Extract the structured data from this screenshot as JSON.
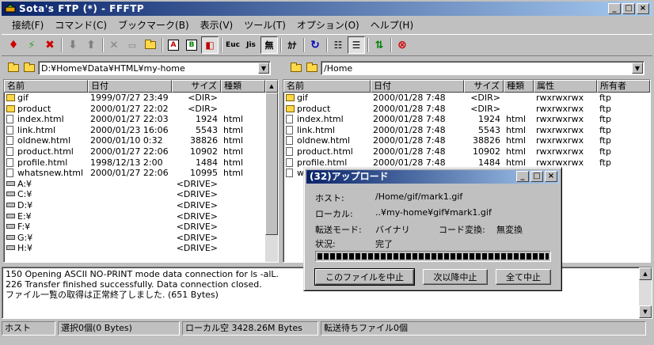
{
  "window": {
    "title": "Sota's FTP (*) - FFFTP"
  },
  "menu": [
    "接続(F)",
    "コマンド(C)",
    "ブックマーク(B)",
    "表示(V)",
    "ツール(T)",
    "オプション(O)",
    "ヘルプ(H)"
  ],
  "toolbar": {
    "ascii_label": "A",
    "binary_label": "B",
    "euc_label": "Euc",
    "jis_label": "Jis",
    "none_label": "無",
    "kana_label": "ｶﾅ"
  },
  "local": {
    "path": "D:¥Home¥Data¥HTML¥my-home",
    "columns": [
      "名前",
      "日付",
      "サイズ",
      "種類"
    ],
    "rows": [
      {
        "name": "gif",
        "date": "1999/07/27 23:49",
        "size": "<DIR>",
        "type": "",
        "kind": "folder"
      },
      {
        "name": "product",
        "date": "2000/01/27 22:02",
        "size": "<DIR>",
        "type": "",
        "kind": "folder"
      },
      {
        "name": "index.html",
        "date": "2000/01/27 22:03",
        "size": "1924",
        "type": "html",
        "kind": "file"
      },
      {
        "name": "link.html",
        "date": "2000/01/23 16:06",
        "size": "5543",
        "type": "html",
        "kind": "file"
      },
      {
        "name": "oldnew.html",
        "date": "2000/01/10  0:32",
        "size": "38826",
        "type": "html",
        "kind": "file"
      },
      {
        "name": "product.html",
        "date": "2000/01/27 22:06",
        "size": "10902",
        "type": "html",
        "kind": "file"
      },
      {
        "name": "profile.html",
        "date": "1998/12/13  2:00",
        "size": "1484",
        "type": "html",
        "kind": "file"
      },
      {
        "name": "whatsnew.html",
        "date": "2000/01/27 22:06",
        "size": "10995",
        "type": "html",
        "kind": "file"
      },
      {
        "name": "A:¥",
        "date": "",
        "size": "<DRIVE>",
        "type": "",
        "kind": "drive"
      },
      {
        "name": "C:¥",
        "date": "",
        "size": "<DRIVE>",
        "type": "",
        "kind": "drive"
      },
      {
        "name": "D:¥",
        "date": "",
        "size": "<DRIVE>",
        "type": "",
        "kind": "drive"
      },
      {
        "name": "E:¥",
        "date": "",
        "size": "<DRIVE>",
        "type": "",
        "kind": "drive"
      },
      {
        "name": "F:¥",
        "date": "",
        "size": "<DRIVE>",
        "type": "",
        "kind": "drive"
      },
      {
        "name": "G:¥",
        "date": "",
        "size": "<DRIVE>",
        "type": "",
        "kind": "drive"
      },
      {
        "name": "H:¥",
        "date": "",
        "size": "<DRIVE>",
        "type": "",
        "kind": "drive"
      }
    ]
  },
  "remote": {
    "path": "/Home",
    "columns": [
      "名前",
      "日付",
      "サイズ",
      "種類",
      "属性",
      "所有者"
    ],
    "rows": [
      {
        "name": "gif",
        "date": "2000/01/28  7:48",
        "size": "<DIR>",
        "type": "",
        "attr": "rwxrwxrwx",
        "owner": "ftp",
        "kind": "folder"
      },
      {
        "name": "product",
        "date": "2000/01/28  7:48",
        "size": "<DIR>",
        "type": "",
        "attr": "rwxrwxrwx",
        "owner": "ftp",
        "kind": "folder"
      },
      {
        "name": "index.html",
        "date": "2000/01/28  7:48",
        "size": "1924",
        "type": "html",
        "attr": "rwxrwxrwx",
        "owner": "ftp",
        "kind": "file"
      },
      {
        "name": "link.html",
        "date": "2000/01/28  7:48",
        "size": "5543",
        "type": "html",
        "attr": "rwxrwxrwx",
        "owner": "ftp",
        "kind": "file"
      },
      {
        "name": "oldnew.html",
        "date": "2000/01/28  7:48",
        "size": "38826",
        "type": "html",
        "attr": "rwxrwxrwx",
        "owner": "ftp",
        "kind": "file"
      },
      {
        "name": "product.html",
        "date": "2000/01/28  7:48",
        "size": "10902",
        "type": "html",
        "attr": "rwxrwxrwx",
        "owner": "ftp",
        "kind": "file"
      },
      {
        "name": "profile.html",
        "date": "2000/01/28  7:48",
        "size": "1484",
        "type": "html",
        "attr": "rwxrwxrwx",
        "owner": "ftp",
        "kind": "file"
      },
      {
        "name": "w",
        "date": "",
        "size": "",
        "type": "",
        "attr": "",
        "owner": "",
        "kind": "file"
      }
    ]
  },
  "log": [
    "150 Opening ASCII NO-PRINT mode data connection for ls -alL.",
    "226 Transfer finished successfully. Data connection closed.",
    "ファイル一覧の取得は正常終了しました. (651 Bytes)"
  ],
  "status": {
    "host": "ホスト",
    "selected": "選択0個(0 Bytes)",
    "local_free": "ローカル空 3428.26M Bytes",
    "queue": "転送待ちファイル0個"
  },
  "dialog": {
    "title": "(32)アップロード",
    "host_label": "ホスト:",
    "host_value": "/Home/gif/mark1.gif",
    "local_label": "ローカル:",
    "local_value": "..¥my-home¥gif¥mark1.gif",
    "mode_label": "転送モード:",
    "mode_value": "バイナリ",
    "code_label": "コード変換:",
    "code_value": "無変換",
    "state_label": "状況:",
    "state_value": "完了",
    "progress": 1.0,
    "btn_cancel_file": "このファイルを中止",
    "btn_cancel_next": "次以降中止",
    "btn_cancel_all": "全て中止"
  }
}
